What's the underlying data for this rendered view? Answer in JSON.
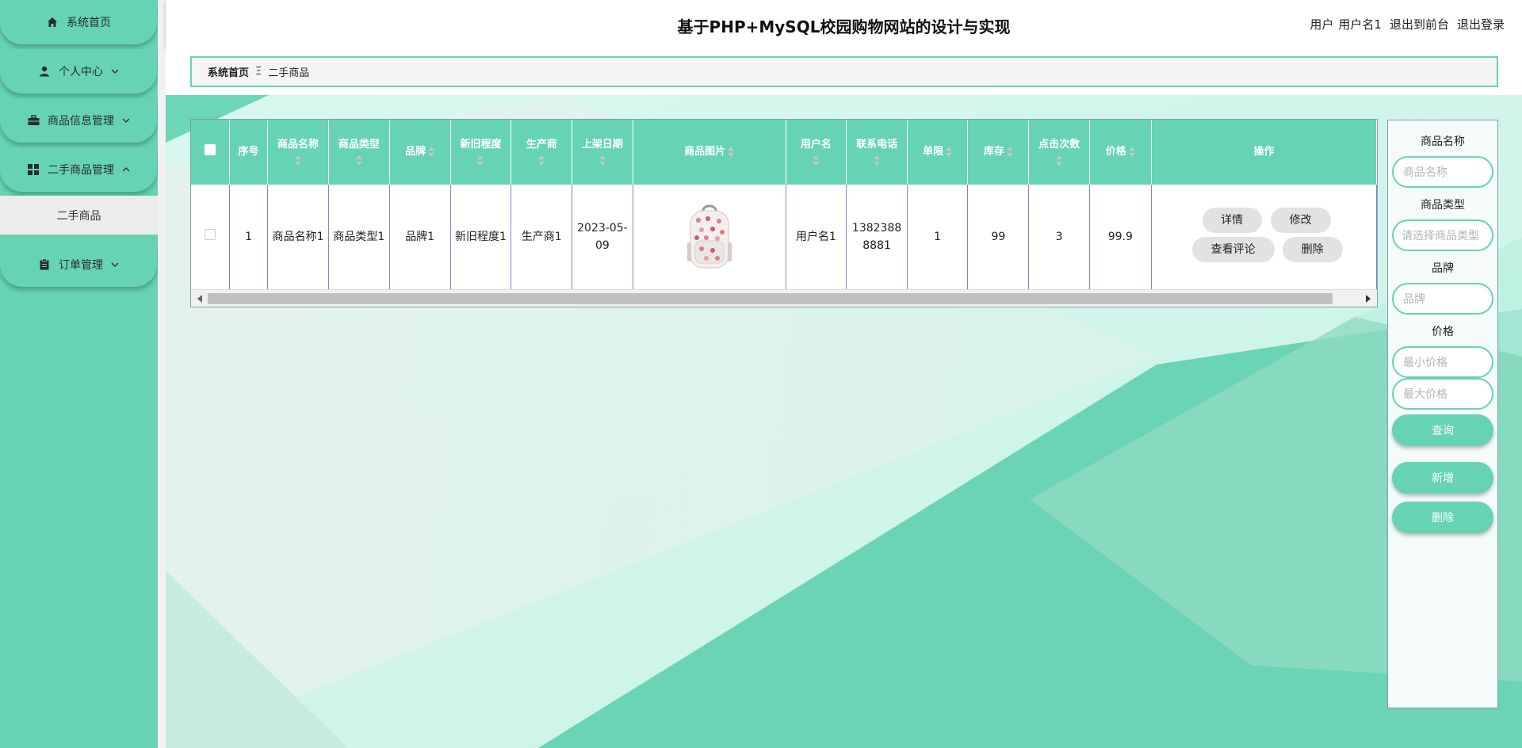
{
  "sidebar": {
    "items": [
      {
        "label": "系统首页",
        "icon": "home-icon"
      },
      {
        "label": "个人中心",
        "icon": "user-icon"
      },
      {
        "label": "商品信息管理",
        "icon": "briefcase-icon"
      },
      {
        "label": "二手商品管理",
        "icon": "grid-icon"
      },
      {
        "label": "订单管理",
        "icon": "clipboard-icon"
      }
    ],
    "sub_item": "二手商品"
  },
  "header": {
    "title": "基于PHP+MySQL校园购物网站的设计与实现",
    "user_label": "用户",
    "user_name": "用户名1",
    "exit_front": "退出到前台",
    "logout": "退出登录"
  },
  "breadcrumb": {
    "home": "系统首页",
    "separator": "Ξ",
    "current": "二手商品"
  },
  "table": {
    "headers": [
      "序号",
      "商品名称",
      "商品类型",
      "品牌",
      "新旧程度",
      "生产商",
      "上架日期",
      "商品图片",
      "用户名",
      "联系电话",
      "单限",
      "库存",
      "点击次数",
      "价格",
      "操作"
    ],
    "rows": [
      {
        "index": "1",
        "name": "商品名称1",
        "type": "商品类型1",
        "brand": "品牌1",
        "condition": "新旧程度1",
        "maker": "生产商1",
        "date": "2023-05-09",
        "image": "backpack-image",
        "user": "用户名1",
        "phone": "13823888881",
        "limit": "1",
        "stock": "99",
        "clicks": "3",
        "price": "99.9"
      }
    ],
    "actions": {
      "detail": "详情",
      "edit": "修改",
      "comments": "查看评论",
      "delete": "删除"
    }
  },
  "search": {
    "name_label": "商品名称",
    "name_placeholder": "商品名称",
    "type_label": "商品类型",
    "type_placeholder": "请选择商品类型",
    "brand_label": "品牌",
    "brand_placeholder": "品牌",
    "price_label": "价格",
    "min_placeholder": "最小价格",
    "max_placeholder": "最大价格",
    "query": "查询",
    "add": "新增",
    "delete": "删除"
  },
  "colors": {
    "accent": "#66d4b4",
    "sidebar_bg": "#66d4b4",
    "background": "#d2f6ec"
  }
}
